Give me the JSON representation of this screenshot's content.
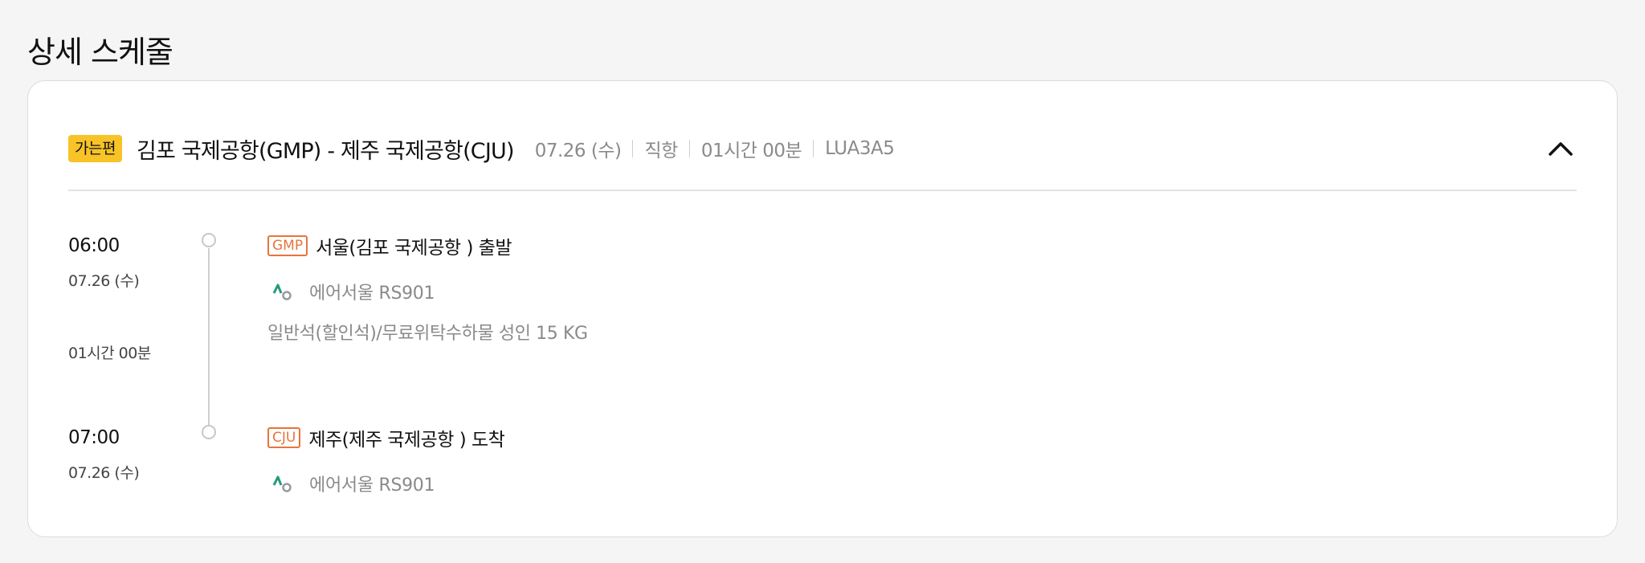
{
  "page": {
    "title": "상세 스케줄"
  },
  "card": {
    "tag": "가는편",
    "route": "김포 국제공항(GMP) - 제주 국제공항(CJU)",
    "meta": [
      "07.26 (수)",
      "직항",
      "01시간 00분",
      "LUA3A5"
    ],
    "toggle_icon": "chevron-up-icon"
  },
  "segment": {
    "departure": {
      "time": "06:00",
      "date": "07.26 (수)",
      "code": "GMP",
      "label": "서울(김포 국제공항 ) 출발",
      "airline": "에어서울 RS901"
    },
    "duration": "01시간 00분",
    "fare": "일반석(할인석)/무료위탁수하물 성인 15 KG",
    "arrival": {
      "time": "07:00",
      "date": "07.26 (수)",
      "code": "CJU",
      "label": "제주(제주 국제공항 ) 도착",
      "airline": "에어서울 RS901"
    }
  },
  "colors": {
    "tag_bg": "#f7c327",
    "code_accent": "#e8743b",
    "airline_logo_green": "#1f9a7c",
    "muted_text": "#8a8a8a"
  }
}
